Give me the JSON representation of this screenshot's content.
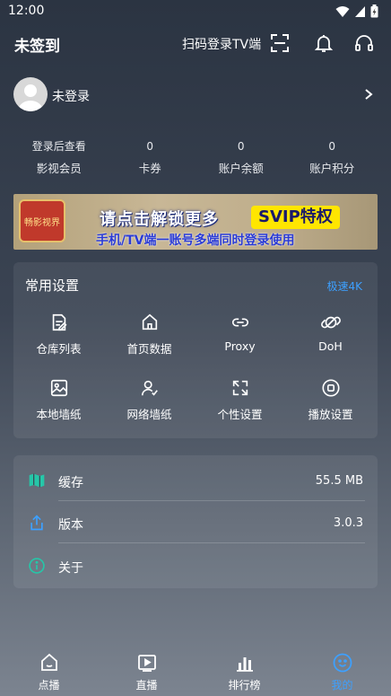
{
  "status_bar": {
    "time": "12:00",
    "icons": [
      "wifi-icon",
      "signal-icon",
      "battery-icon"
    ]
  },
  "header": {
    "checkin_label": "未签到",
    "scan_label": "扫码登录TV端"
  },
  "profile": {
    "login_label": "未登录"
  },
  "stats": [
    {
      "value": "登录后查看",
      "label": "影视会员"
    },
    {
      "value": "0",
      "label": "卡券"
    },
    {
      "value": "0",
      "label": "账户余额"
    },
    {
      "value": "0",
      "label": "账户积分"
    }
  ],
  "banner": {
    "logo_text": "畅影视界",
    "line1": "请点击解锁更多",
    "tag": "SVIP特权",
    "line2": "手机/TV端一账号多端同时登录使用"
  },
  "settings": {
    "title": "常用设置",
    "speed_link": "极速4K",
    "items": [
      {
        "label": "仓库列表",
        "icon": "repository-list-icon"
      },
      {
        "label": "首页数据",
        "icon": "home-data-icon"
      },
      {
        "label": "Proxy",
        "icon": "proxy-link-icon"
      },
      {
        "label": "DoH",
        "icon": "doh-link-icon"
      },
      {
        "label": "本地墙纸",
        "icon": "local-wallpaper-icon"
      },
      {
        "label": "网络墙纸",
        "icon": "network-wallpaper-icon"
      },
      {
        "label": "个性设置",
        "icon": "personalize-icon"
      },
      {
        "label": "播放设置",
        "icon": "playback-settings-icon"
      }
    ]
  },
  "info": {
    "cache": {
      "label": "缓存",
      "value": "55.5 MB"
    },
    "version": {
      "label": "版本",
      "value": "3.0.3"
    },
    "about": {
      "label": "关于"
    }
  },
  "nav": [
    {
      "label": "点播",
      "icon": "home-icon"
    },
    {
      "label": "直播",
      "icon": "live-icon"
    },
    {
      "label": "排行榜",
      "icon": "ranking-icon"
    },
    {
      "label": "我的",
      "icon": "profile-icon"
    }
  ],
  "colors": {
    "accent": "#3da0ff",
    "teal": "#26c6a8"
  }
}
